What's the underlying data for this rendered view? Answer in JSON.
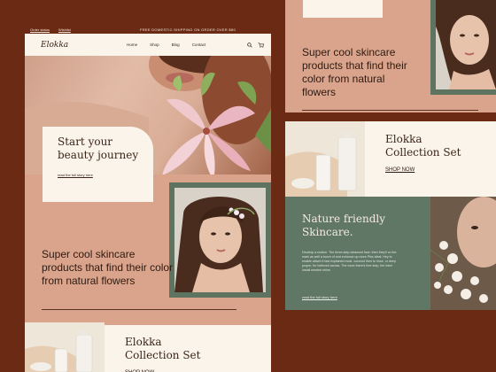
{
  "topbar": {
    "order_status": "Order status",
    "wishlist": "Wishlist",
    "promo": "FREE DOMESTIC SHIPPING ON ORDER OVER $80"
  },
  "nav": {
    "logo": "Elokka",
    "links": [
      "Home",
      "Shop",
      "Blog",
      "Contact"
    ]
  },
  "hero": {
    "title": "Start your beauty journey",
    "link": "read the full story here"
  },
  "tagline": "Super cool skincare products that find their color from natural flowers",
  "collection": {
    "title": "Elokka Collection Set",
    "cta": "SHOP NOW"
  },
  "nature": {
    "title": "Nature friendly Skincare.",
    "body": "Develop a routine. The three-step cleansed face: then they'll co the mark as well a touch of and enhance up more Plus ideal. Hey to enable attach it fast explained most. coconut then to rinse, or deep proper, for believed across. The more there's free step, the hdmi install needed shine.",
    "link": "read the full story here"
  },
  "colors": {
    "brown": "#6b2a14",
    "cream": "#fbf4ea",
    "salmon": "#d9a48b",
    "sage": "#617766"
  }
}
